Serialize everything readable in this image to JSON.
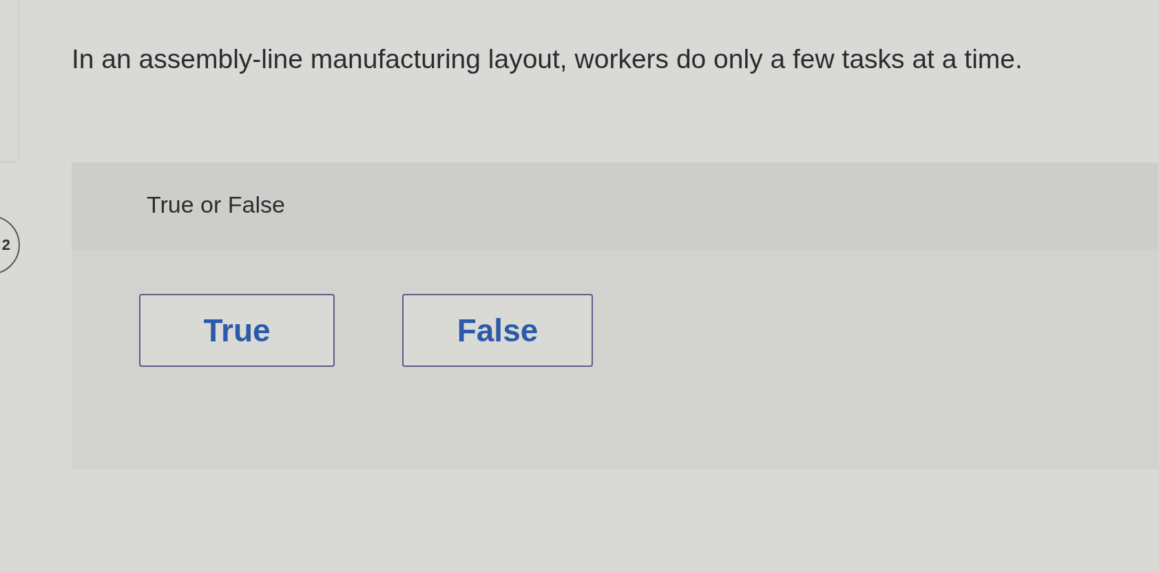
{
  "question": {
    "number": "2",
    "text": "In an assembly-line manufacturing layout, workers do only a few tasks at a time."
  },
  "answer_panel": {
    "prompt": "True or False",
    "options": [
      {
        "label": "True",
        "selected": false
      },
      {
        "label": "False",
        "selected": false
      }
    ]
  }
}
